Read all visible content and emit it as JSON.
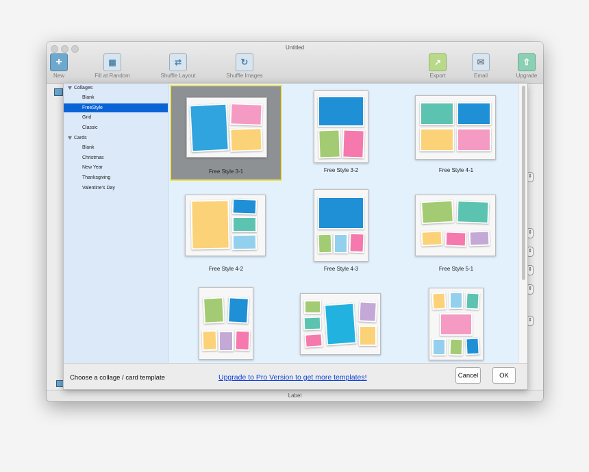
{
  "window": {
    "title": "Untitled",
    "status_label": "Label"
  },
  "toolbar": {
    "new": {
      "label": "New",
      "icon": "plus-icon"
    },
    "fill_random": {
      "label": "Fill at Random",
      "icon": "random-fill-icon"
    },
    "shuffle_layout": {
      "label": "Shuffle Layout",
      "icon": "shuffle-layout-icon"
    },
    "shuffle_images": {
      "label": "Shuffle Images",
      "icon": "shuffle-images-icon"
    },
    "export": {
      "label": "Export",
      "icon": "export-icon"
    },
    "email": {
      "label": "Email",
      "icon": "envelope-icon"
    },
    "upgrade": {
      "label": "Upgrade",
      "icon": "upload-arrow-icon"
    }
  },
  "sidebar": {
    "groups": [
      {
        "label": "Collages",
        "items": [
          "Blank",
          "FreeStyle",
          "Grid",
          "Classic"
        ]
      },
      {
        "label": "Cards",
        "items": [
          "Blank",
          "Christmas",
          "New Year",
          "Thanksgiving",
          "Valentine's Day"
        ]
      }
    ],
    "selected": "FreeStyle"
  },
  "templates": [
    {
      "name": "Free Style 3-1",
      "selected": true
    },
    {
      "name": "Free Style 3-2"
    },
    {
      "name": "Free Style 4-1"
    },
    {
      "name": "Free Style 4-2"
    },
    {
      "name": "Free Style 4-3"
    },
    {
      "name": "Free Style 5-1"
    },
    {
      "name": ""
    },
    {
      "name": ""
    },
    {
      "name": ""
    }
  ],
  "footer": {
    "label": "Choose a collage / card template",
    "upgrade_link": "Upgrade to Pro Version to get more templates!",
    "cancel": "Cancel",
    "ok": "OK"
  },
  "colors": {
    "selection": "#0b64d6",
    "link": "#0b3fdc",
    "highlight_border": "#f0e35a",
    "photo_blue": "#1f8fd6",
    "photo_pink": "#f59ac3",
    "photo_yellow": "#fbd277",
    "photo_green": "#a3cb73",
    "photo_teal": "#5cc3b0",
    "photo_lightblue": "#92d0ee",
    "photo_purple": "#c4a9d6"
  }
}
